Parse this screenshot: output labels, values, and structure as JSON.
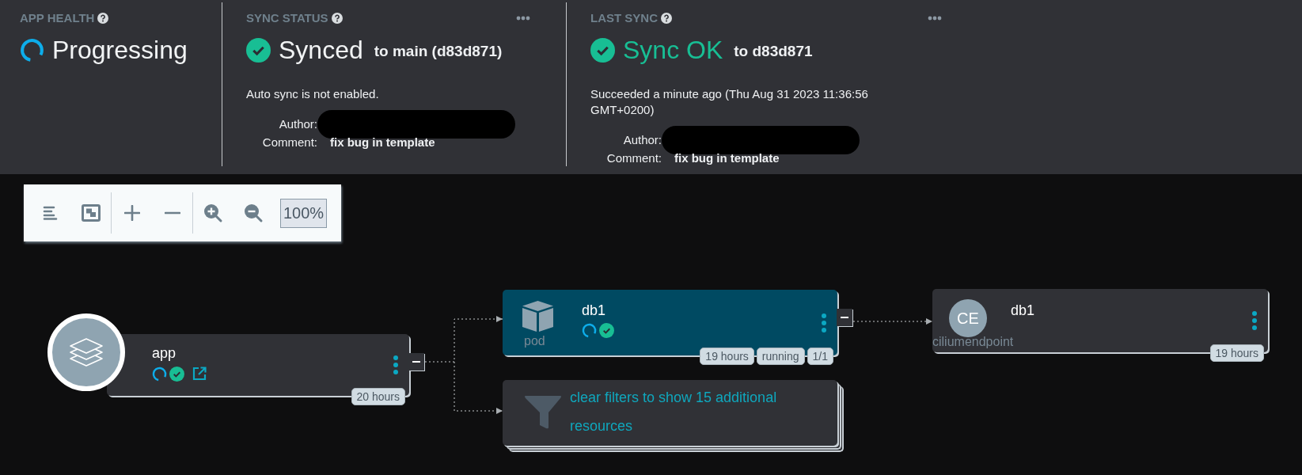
{
  "header": {
    "panels": [
      {
        "kind": "health",
        "title": "APP HEALTH",
        "status": "Progressing"
      },
      {
        "kind": "sync",
        "title": "SYNC STATUS",
        "status": "Synced",
        "success": false,
        "target": "to main (d83d871)",
        "message": "Auto sync is not enabled.",
        "fields": [
          {
            "label": "Author:",
            "redacted": true
          },
          {
            "label": "Comment:",
            "value": "fix bug in template"
          }
        ]
      },
      {
        "kind": "sync",
        "title": "LAST SYNC",
        "status": "Sync OK",
        "success": true,
        "target": "to d83d871",
        "message": "Succeeded a minute ago (Thu Aug 31 2023 11:36:56 GMT+0200)",
        "fields": [
          {
            "label": "Author:",
            "redacted": true
          },
          {
            "label": "Comment:",
            "value": "fix bug in template"
          }
        ]
      }
    ]
  },
  "toolbar": {
    "zoom": "100%"
  },
  "graph": {
    "nodes": [
      {
        "kind": "app",
        "name": "app",
        "progressing": true,
        "synced": true,
        "link": true,
        "tags": [
          "20 hours"
        ],
        "selected": false,
        "collapsible": true
      },
      {
        "kind": "pod",
        "name": "db1",
        "type_label": "pod",
        "progressing": true,
        "synced": true,
        "tags": [
          "19 hours",
          "running",
          "1/1"
        ],
        "selected": true,
        "collapsible": true
      },
      {
        "kind": "filter",
        "text": "clear filters to show 15 additional resources"
      },
      {
        "kind": "abbrev",
        "name": "db1",
        "abbrev": "CE",
        "type_label": "ciliumendpoint",
        "tags": [
          "19 hours"
        ],
        "selected": false
      }
    ]
  }
}
